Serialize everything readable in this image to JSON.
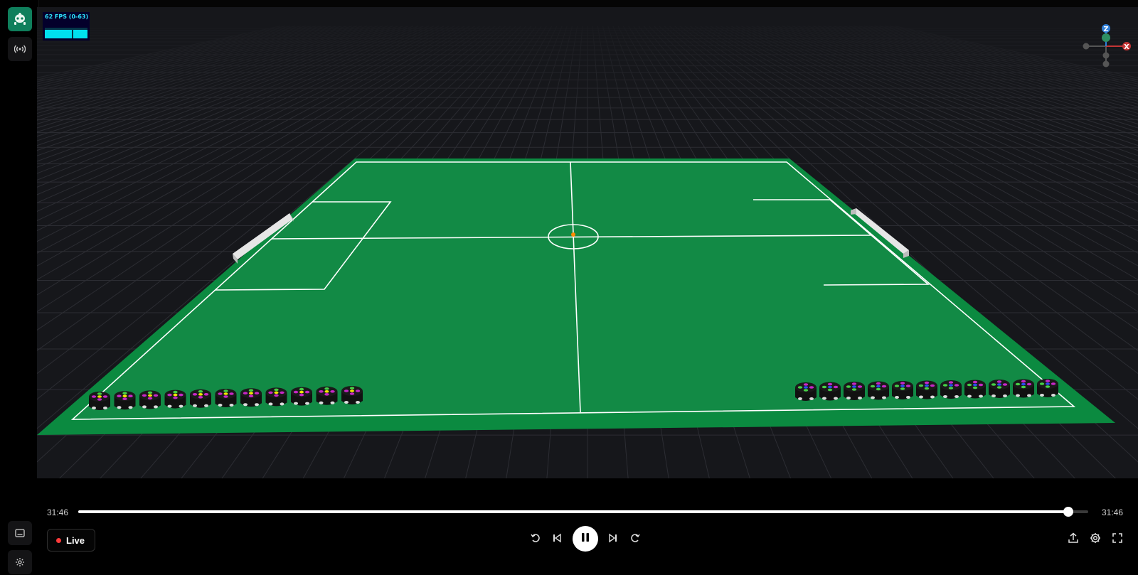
{
  "fps": {
    "label": "62 FPS (0-63)"
  },
  "gizmo": {
    "z_label": "Z",
    "x_label": "X"
  },
  "timeline": {
    "current_time": "31:46",
    "end_time": "31:46",
    "progress": 0.98
  },
  "live": {
    "label": "Live"
  },
  "icons": {
    "app_logo": "robot-icon",
    "broadcast": "broadcast-icon",
    "panel": "panel-icon",
    "settings": "gear-icon"
  },
  "colors": {
    "accent": "#0f7f5c",
    "field": "#128a45",
    "field_border": "#0b8a40",
    "live_dot": "#ff3b3b"
  }
}
